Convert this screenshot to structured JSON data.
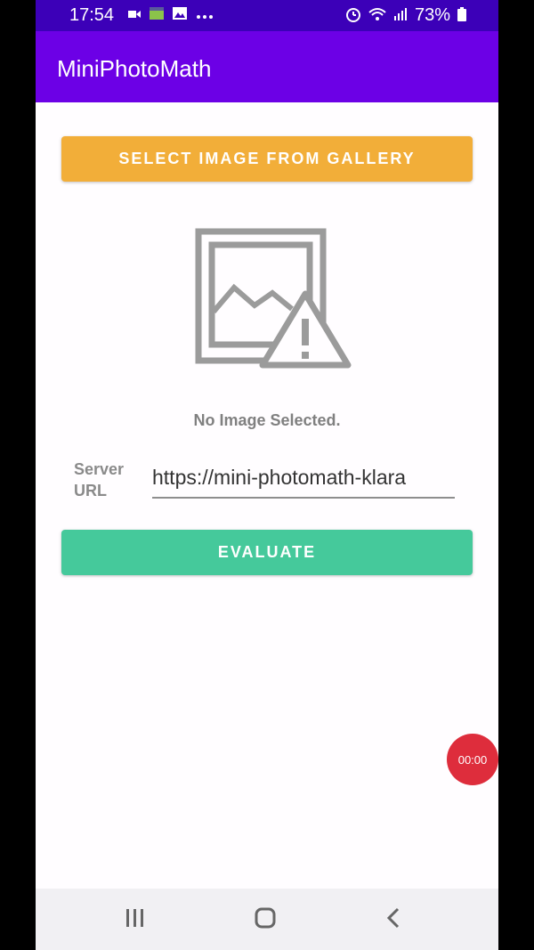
{
  "status_bar": {
    "time": "17:54",
    "battery": "73%",
    "icons_left": [
      "video-icon",
      "data-icon",
      "photos-icon",
      "more-dots-icon"
    ],
    "icons_right": [
      "alarm-icon",
      "wifi-icon",
      "signal-icon",
      "battery-icon"
    ]
  },
  "app_bar": {
    "title": "MiniPhotoMath"
  },
  "gallery_button": {
    "label": "SELECT IMAGE FROM GALLERY",
    "color": "#f2ae39"
  },
  "image_preview": {
    "icon": "broken-image-icon",
    "caption": "No Image Selected."
  },
  "server_url": {
    "label": "Server URL",
    "value": "https://mini-photomath-klara"
  },
  "evaluate_button": {
    "label": "EVALUATE",
    "color": "#45c99b"
  },
  "recorder": {
    "time": "00:00"
  },
  "nav_bar": {
    "items": [
      "recent-apps",
      "home",
      "back"
    ]
  },
  "colors": {
    "status_bar": "#3c00b8",
    "app_bar": "#6c00e6"
  }
}
